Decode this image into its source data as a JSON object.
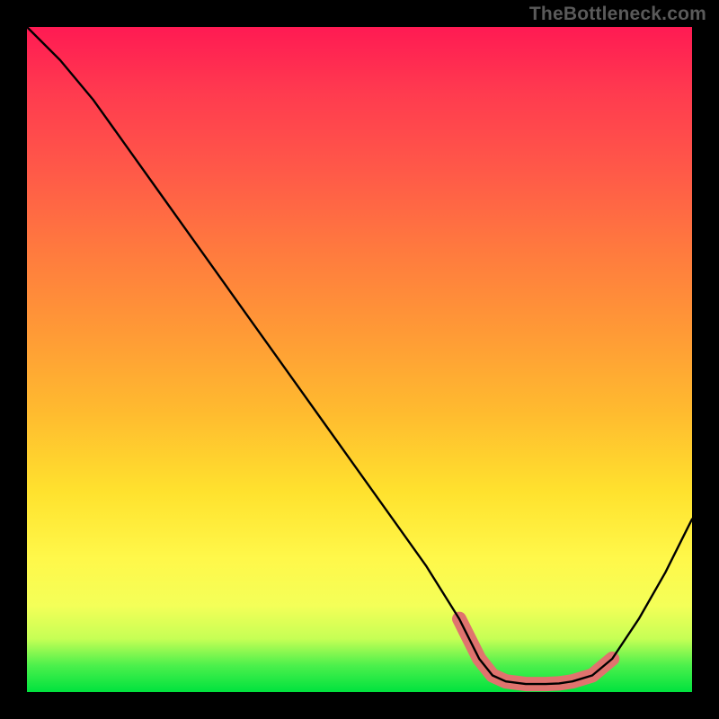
{
  "watermark": {
    "text": "TheBottleneck.com"
  },
  "chart_data": {
    "type": "line",
    "title": "",
    "xlabel": "",
    "ylabel": "",
    "xlim": [
      0,
      100
    ],
    "ylim": [
      0,
      100
    ],
    "series": [
      {
        "name": "bottleneck-curve",
        "x": [
          0,
          5,
          10,
          15,
          20,
          25,
          30,
          35,
          40,
          45,
          50,
          55,
          60,
          65,
          68,
          70,
          72,
          75,
          78,
          80,
          82,
          85,
          88,
          92,
          96,
          100
        ],
        "y": [
          100,
          95,
          89,
          82,
          75,
          68,
          61,
          54,
          47,
          40,
          33,
          26,
          19,
          11,
          5,
          2.5,
          1.6,
          1.2,
          1.2,
          1.3,
          1.6,
          2.5,
          5,
          11,
          18,
          26
        ]
      },
      {
        "name": "highlight-band",
        "x": [
          65,
          68,
          70,
          72,
          75,
          78,
          80,
          82,
          85,
          88
        ],
        "y": [
          11,
          5,
          2.5,
          1.6,
          1.2,
          1.2,
          1.3,
          1.6,
          2.5,
          5
        ]
      }
    ],
    "gradient_stops": [
      {
        "pos": 0,
        "color": "#ff1a53"
      },
      {
        "pos": 50,
        "color": "#ff9a36"
      },
      {
        "pos": 80,
        "color": "#fff84a"
      },
      {
        "pos": 100,
        "color": "#00e23e"
      }
    ]
  }
}
